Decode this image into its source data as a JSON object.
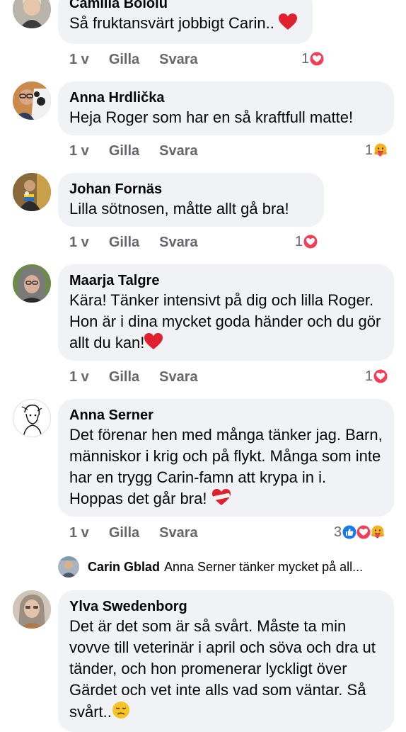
{
  "comments": [
    {
      "author": "Camilla Bololu",
      "text": "Så fruktansvärt jobbigt Carin..",
      "time": "1 v",
      "like": "Gilla",
      "reply": "Svara",
      "reaction_count": "1",
      "reactions": [
        "heart-reaction"
      ]
    },
    {
      "author": "Anna Hrdlička",
      "text": "Heja Roger som har en så kraftfull matte!",
      "time": "1 v",
      "like": "Gilla",
      "reply": "Svara",
      "reaction_count": "1",
      "reactions": [
        "care-reaction"
      ]
    },
    {
      "author": "Johan Fornäs",
      "text": "Lilla sötnosen, måtte allt gå bra!",
      "time": "1 v",
      "like": "Gilla",
      "reply": "Svara",
      "reaction_count": "1",
      "reactions": [
        "heart-reaction"
      ]
    },
    {
      "author": "Maarja Talgre",
      "text": "Kära! Tänker intensivt på dig och lilla Roger. Hon är i dina mycket goda händer och du gör allt du kan!",
      "time": "1 v",
      "like": "Gilla",
      "reply": "Svara",
      "reaction_count": "1",
      "reactions": [
        "heart-reaction"
      ]
    },
    {
      "author": "Anna Serner",
      "text": "Det förenar hen med många tänker jag. Barn, människor i krig och på flykt. Många som inte har en trygg Carin-famn att krypa in i. Hoppas det går bra!",
      "time": "1 v",
      "like": "Gilla",
      "reply": "Svara",
      "reaction_count": "3",
      "reactions": [
        "like-reaction",
        "heart-reaction",
        "care-reaction"
      ]
    },
    {
      "author": "Ylva Swedenborg",
      "text": "Det är det som är så svårt. Måste ta min vovve till veterinär i april och söva och dra  ut tänder, och hon promenerar lyckligt över Gärdet och vet inte alls vad som väntar. Så svårt..",
      "time": "",
      "like": "",
      "reply": "",
      "reaction_count": "",
      "reactions": []
    }
  ],
  "reply_preview": {
    "author": "Carin Gblad",
    "text": "Anna Serner tänker mycket på all..."
  },
  "colors": {
    "bubble": "#f0f2f5",
    "meta": "#65676b",
    "heart": "#f33e58",
    "like": "#1877f2",
    "care": "#f7b125"
  }
}
